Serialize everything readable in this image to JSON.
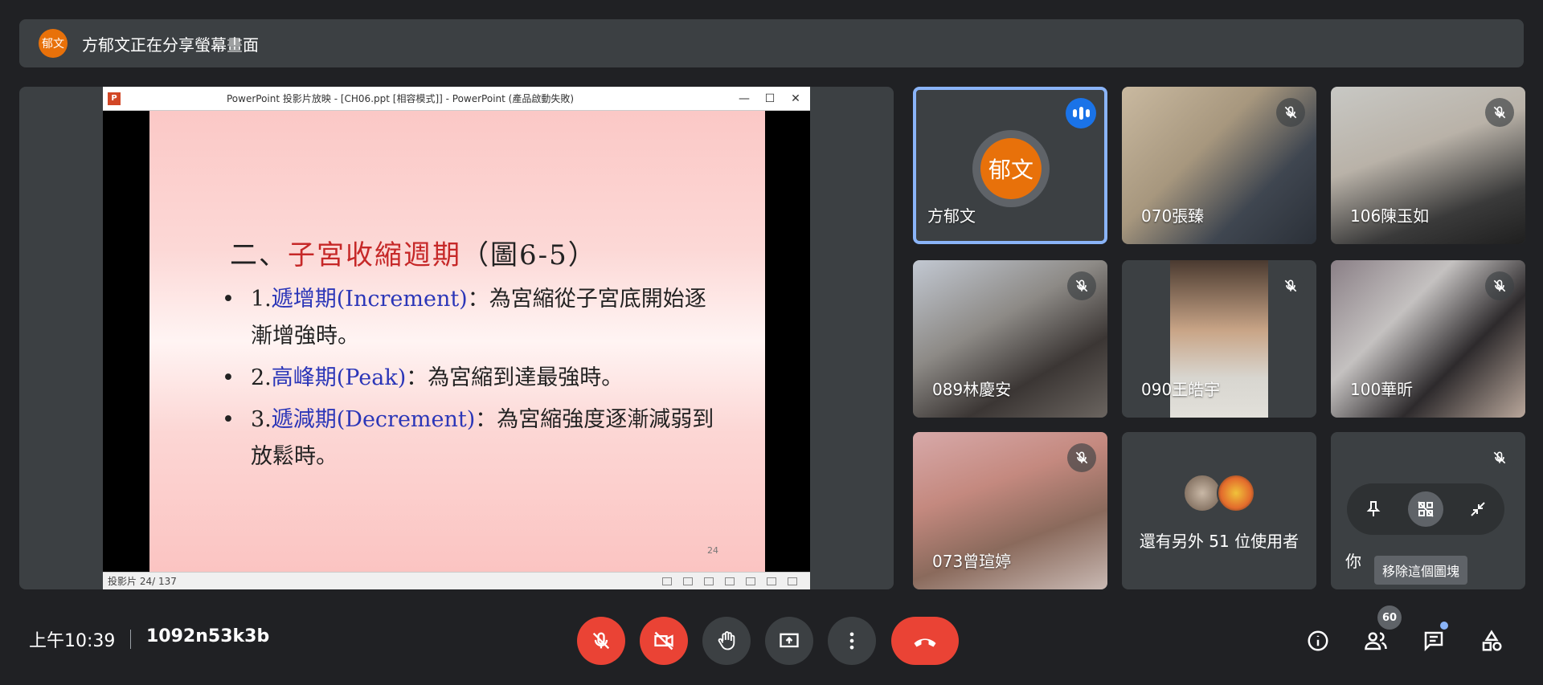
{
  "banner": {
    "avatar_text": "郁文",
    "text": "方郁文正在分享螢幕畫面"
  },
  "presentation": {
    "window_title": "PowerPoint 投影片放映 - [CH06.ppt [相容模式]] - PowerPoint (產品啟動失敗)",
    "app_icon": "P",
    "slide": {
      "heading_prefix": "二、",
      "heading_red": "子宮收縮週期",
      "heading_suffix": "（圖6-5）",
      "bullets": [
        {
          "num": "1.",
          "term": "遞增期(Increment)",
          "text": "：為宮縮從子宮底開始逐漸增強時。"
        },
        {
          "num": "2.",
          "term": "高峰期(Peak)",
          "text": "：為宮縮到達最強時。"
        },
        {
          "num": "3.",
          "term": "遞減期(Decrement)",
          "text": "：為宮縮強度逐漸減弱到放鬆時。"
        }
      ],
      "page_number": "24"
    },
    "status_text": "投影片 24/ 137"
  },
  "participants": [
    {
      "name": "方郁文",
      "avatar_text": "郁文"
    },
    {
      "name": "070張臻"
    },
    {
      "name": "106陳玉如"
    },
    {
      "name": "089林慶安"
    },
    {
      "name": "090王皓宇"
    },
    {
      "name": "100華昕"
    },
    {
      "name": "073曾瑄婷"
    }
  ],
  "others": {
    "label": "還有另外 51 位使用者"
  },
  "self_tile": {
    "label": "你",
    "tooltip": "移除這個圖塊"
  },
  "bottom_bar": {
    "time": "上午10:39",
    "meeting_code": "1092n53k3b",
    "people_count": "60"
  },
  "colors": {
    "background": "#202124",
    "tile": "#3c4043",
    "accent_red": "#ea4335",
    "active_border": "#8ab4f8",
    "avatar_orange": "#e8710a"
  }
}
